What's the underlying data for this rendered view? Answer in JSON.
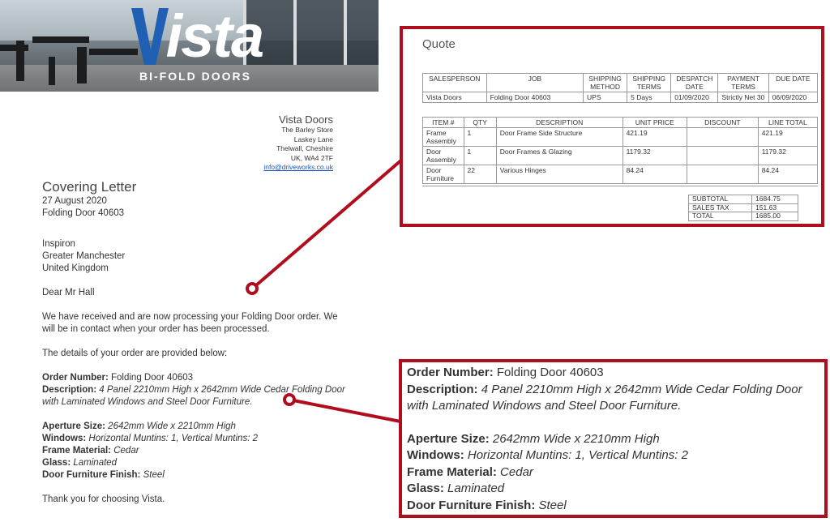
{
  "banner": {
    "logo_word": "Vista",
    "logo_sub": "BI-FOLD DOORS"
  },
  "company": {
    "name": "Vista Doors",
    "address": [
      "The Barley Store",
      "Laskey Lane",
      "Thelwall, Cheshire",
      "UK, WA4 2TF"
    ],
    "email": "info@driveworks.co.uk"
  },
  "letter": {
    "title": "Covering Letter",
    "date": "27 August 2020",
    "reference": "Folding Door 40603",
    "recipient": [
      "Inspiron",
      "Greater Manchester",
      "United Kingdom"
    ],
    "greeting": "Dear Mr Hall",
    "para1": "We have received and are now processing your Folding Door order. We will be in contact when your order has been processed.",
    "para2": "The details of your order are provided below:",
    "closing": "Thank you for choosing Vista."
  },
  "order": {
    "order_number_label": "Order Number:",
    "order_number": "Folding Door 40603",
    "description_label": "Description:",
    "description": "4 Panel 2210mm High x 2642mm Wide Cedar Folding Door with Laminated Windows and Steel Door Furniture.",
    "aperture_label": "Aperture Size:",
    "aperture": "2642mm Wide x 2210mm High",
    "windows_label": "Windows:",
    "windows": "Horizontal Muntins: 1, Vertical Muntins: 2",
    "frame_label": "Frame Material:",
    "frame": "Cedar",
    "glass_label": "Glass:",
    "glass": "Laminated",
    "finish_label": "Door Furniture Finish:",
    "finish": "Steel"
  },
  "quote": {
    "title": "Quote",
    "header_columns": [
      "SALESPERSON",
      "JOB",
      "SHIPPING METHOD",
      "SHIPPING TERMS",
      "DESPATCH DATE",
      "PAYMENT TERMS",
      "DUE DATE"
    ],
    "header_values": [
      "Vista Doors",
      "Folding Door 40603",
      "UPS",
      "5 Days",
      "01/09/2020",
      "Strictly Net 30",
      "06/09/2020"
    ],
    "item_columns": [
      "ITEM #",
      "QTY",
      "DESCRIPTION",
      "UNIT PRICE",
      "DISCOUNT",
      "LINE TOTAL"
    ],
    "items": [
      [
        "Frame Assembly",
        "1",
        "Door Frame Side Structure",
        "421.19",
        "",
        "421.19"
      ],
      [
        "Door Assembly",
        "1",
        "Door Frames & Glazing",
        "1179.32",
        "",
        "1179.32"
      ],
      [
        "Door Furniture",
        "22",
        "Various Hinges",
        "84.24",
        "",
        "84.24"
      ]
    ],
    "totals": [
      [
        "SUBTOTAL",
        "1684.75"
      ],
      [
        "SALES TAX",
        "151.63"
      ],
      [
        "TOTAL",
        "1685.00"
      ]
    ]
  },
  "colors": {
    "accent_red": "#b00d1e",
    "link_blue": "#1a55c0",
    "logo_blue": "#1f5fb4"
  }
}
